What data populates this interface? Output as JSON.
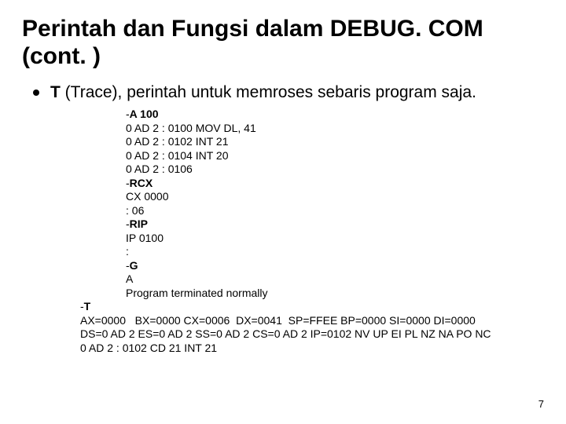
{
  "title": "Perintah dan Fungsi dalam DEBUG. COM  (cont. )",
  "bullet": {
    "cmd": "T",
    "desc": " (Trace), perintah untuk memroses sebaris program saja."
  },
  "code": {
    "l1_prefix": "-",
    "l1_cmd": "A 100",
    "l2": "0 AD 2 : 0100 MOV DL, 41",
    "l3": "0 AD 2 : 0102 INT 21",
    "l4": "0 AD 2 : 0104 INT 20",
    "l5": "0 AD 2 : 0106",
    "l6_prefix": "-",
    "l6_cmd": "RCX",
    "l7": "CX 0000",
    "l8": ": 06",
    "l9_prefix": "-",
    "l9_cmd": "RIP",
    "l10": "IP 0100",
    "l11": ":",
    "l12_prefix": "-",
    "l12_cmd": "G",
    "l13": "A",
    "l14": "Program terminated normally"
  },
  "reg": {
    "r1_prefix": "-",
    "r1_cmd": "T",
    "r2": "AX=0000   BX=0000 CX=0006  DX=0041  SP=FFEE BP=0000 SI=0000 DI=0000",
    "r3": "DS=0 AD 2 ES=0 AD 2 SS=0 AD 2 CS=0 AD 2 IP=0102 NV UP EI PL NZ NA PO NC",
    "r4": "0 AD 2 : 0102 CD 21 INT 21"
  },
  "page": "7"
}
